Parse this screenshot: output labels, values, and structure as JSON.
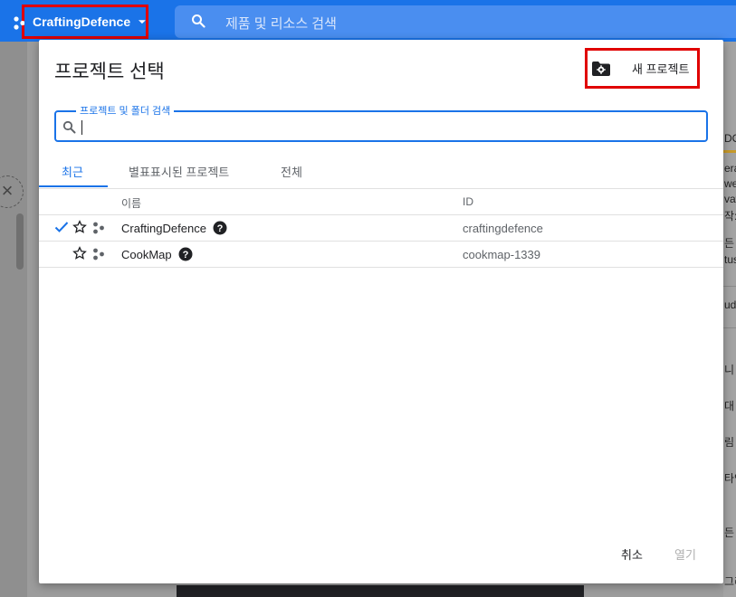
{
  "header": {
    "project_name": "CraftingDefence",
    "search_placeholder": "제품 및 리소스 검색"
  },
  "dialog": {
    "title": "프로젝트 선택",
    "new_project_label": "새 프로젝트",
    "search": {
      "label": "프로젝트 및 폴더 검색",
      "value": ""
    },
    "tabs": [
      {
        "label": "최근",
        "active": true
      },
      {
        "label": "별표표시된 프로젝트",
        "active": false
      },
      {
        "label": "전체",
        "active": false
      }
    ],
    "table": {
      "columns": [
        "이름",
        "ID"
      ],
      "rows": [
        {
          "name": "CraftingDefence",
          "id": "craftingdefence",
          "selected": true
        },
        {
          "name": "CookMap",
          "id": "cookmap-1339",
          "selected": false
        }
      ]
    },
    "cancel_label": "취소",
    "open_label": "열기"
  },
  "background_right_text": [
    "DO",
    "era",
    "we",
    "vat",
    "작:",
    "든",
    "tus",
    "ud",
    "니",
    "대",
    "림",
    "타인",
    "든",
    "그리"
  ],
  "colors": {
    "accent": "#1a73e8",
    "highlight_box": "#e00000"
  }
}
